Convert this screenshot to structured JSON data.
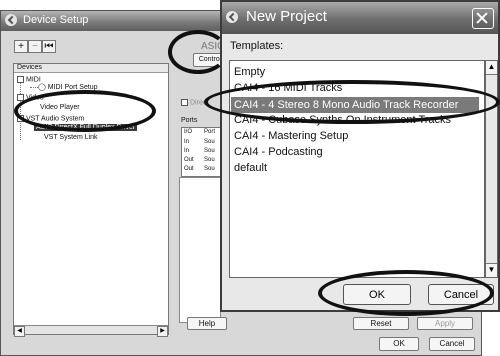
{
  "device_setup": {
    "title": "Device Setup",
    "toolbar": {
      "add": "+",
      "remove": "−",
      "reset": "⏮"
    },
    "devices_header": "Devices",
    "tree": [
      {
        "label": "MIDI"
      },
      {
        "label": "MIDI Port Setup"
      },
      {
        "label": "Video"
      },
      {
        "label": "Video Player"
      },
      {
        "label": "VST Audio System"
      },
      {
        "label": "ASIO DirectX Full Duplex Driver"
      },
      {
        "label": "VST System Link"
      }
    ],
    "driver_title": "ASIO Dir",
    "control_panel_label": "Control",
    "direct_label": "Direc",
    "ports_label": "Ports",
    "ports_columns": [
      "I/O",
      "Port"
    ],
    "ports_rows": [
      [
        "In",
        "Sou"
      ],
      [
        "In",
        "Sou"
      ],
      [
        "Out",
        "Sou"
      ],
      [
        "Out",
        "Sou"
      ]
    ],
    "help_label": "Help",
    "reset_label": "Reset",
    "apply_label": "Apply",
    "ok_label": "OK",
    "cancel_label": "Cancel"
  },
  "new_project": {
    "title": "New Project",
    "templates_label": "Templates:",
    "templates": [
      "Empty",
      "CAI4 - 16 MIDI Tracks",
      "CAI4 - 4 Stereo 8 Mono Audio Track Recorder",
      "CAI4 - Cubase Synths On Instrument Tracks",
      "CAI4 - Mastering Setup",
      "CAI4 - Podcasting",
      "default"
    ],
    "selected_index": 2,
    "ok_label": "OK",
    "cancel_label": "Cancel"
  },
  "colors": {
    "selection": "#7a7a7a",
    "title_bar": "#6e6e6e",
    "callout": "#111111"
  }
}
